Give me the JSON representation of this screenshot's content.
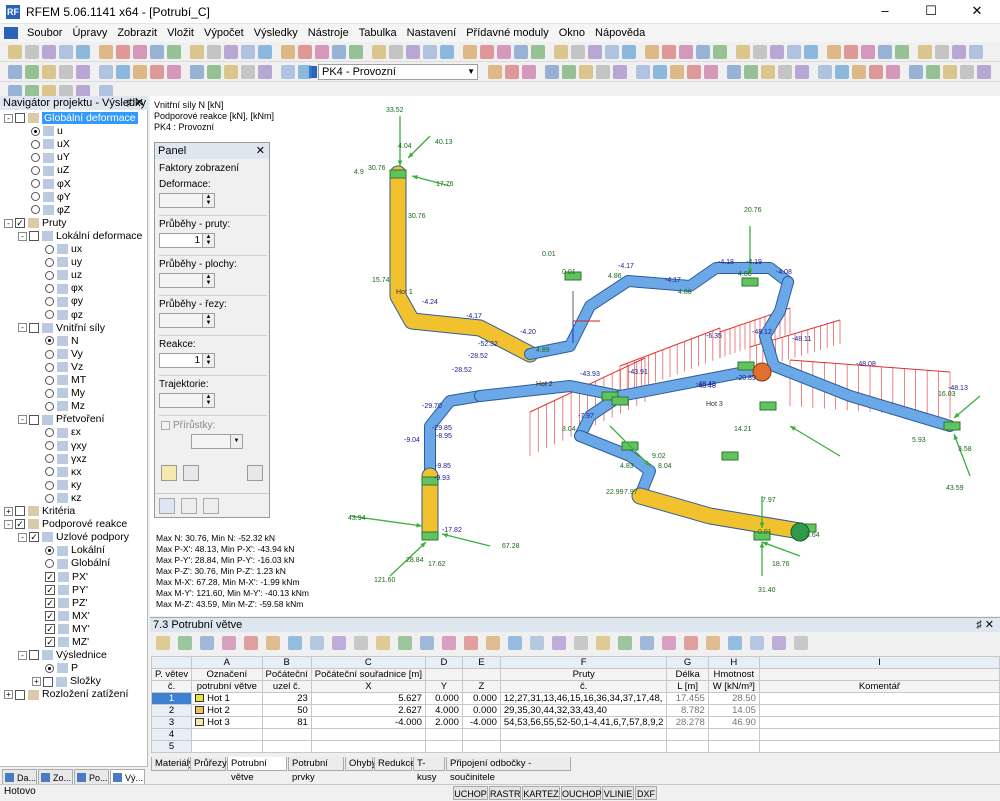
{
  "window": {
    "title": "RFEM 5.06.1141 x64 - [Potrubí_C]",
    "app_icon_text": "RF"
  },
  "menu": [
    "Soubor",
    "Úpravy",
    "Zobrazit",
    "Vložit",
    "Výpočet",
    "Výsledky",
    "Nástroje",
    "Tabulka",
    "Nastavení",
    "Přídavné moduly",
    "Okno",
    "Nápověda"
  ],
  "toolbar": {
    "load_case": "PK4 - Provozní"
  },
  "navigator": {
    "title": "Navigátor projektu - Výsledky",
    "tabs": [
      "Da...",
      "Zo...",
      "Po...",
      "Vý..."
    ],
    "tree": [
      {
        "level": 0,
        "kind": "chk",
        "label": "Globální deformace",
        "selected": true,
        "expander": "-"
      },
      {
        "level": 1,
        "kind": "radio",
        "on": true,
        "label": "u"
      },
      {
        "level": 1,
        "kind": "radio",
        "label": "uX"
      },
      {
        "level": 1,
        "kind": "radio",
        "label": "uY"
      },
      {
        "level": 1,
        "kind": "radio",
        "label": "uZ"
      },
      {
        "level": 1,
        "kind": "radio",
        "label": "φX"
      },
      {
        "level": 1,
        "kind": "radio",
        "label": "φY"
      },
      {
        "level": 1,
        "kind": "radio",
        "label": "φZ"
      },
      {
        "level": 0,
        "kind": "chk",
        "checked": true,
        "label": "Pruty",
        "expander": "-"
      },
      {
        "level": 1,
        "kind": "chk",
        "label": "Lokální deformace",
        "expander": "-"
      },
      {
        "level": 2,
        "kind": "radio",
        "label": "ux"
      },
      {
        "level": 2,
        "kind": "radio",
        "label": "uy"
      },
      {
        "level": 2,
        "kind": "radio",
        "label": "uz"
      },
      {
        "level": 2,
        "kind": "radio",
        "label": "φx"
      },
      {
        "level": 2,
        "kind": "radio",
        "label": "φy"
      },
      {
        "level": 2,
        "kind": "radio",
        "label": "φz"
      },
      {
        "level": 1,
        "kind": "chk",
        "label": "Vnitřní síly",
        "expander": "-"
      },
      {
        "level": 2,
        "kind": "radio",
        "on": true,
        "label": "N"
      },
      {
        "level": 2,
        "kind": "radio",
        "label": "Vy"
      },
      {
        "level": 2,
        "kind": "radio",
        "label": "Vz"
      },
      {
        "level": 2,
        "kind": "radio",
        "label": "MT"
      },
      {
        "level": 2,
        "kind": "radio",
        "label": "My"
      },
      {
        "level": 2,
        "kind": "radio",
        "label": "Mz"
      },
      {
        "level": 1,
        "kind": "chk",
        "label": "Přetvoření",
        "expander": "-"
      },
      {
        "level": 2,
        "kind": "radio",
        "label": "εx"
      },
      {
        "level": 2,
        "kind": "radio",
        "label": "γxy"
      },
      {
        "level": 2,
        "kind": "radio",
        "label": "γxz"
      },
      {
        "level": 2,
        "kind": "radio",
        "label": "κx"
      },
      {
        "level": 2,
        "kind": "radio",
        "label": "κy"
      },
      {
        "level": 2,
        "kind": "radio",
        "label": "κz"
      },
      {
        "level": 0,
        "kind": "chk",
        "label": "Kritéria",
        "expander": "+"
      },
      {
        "level": 0,
        "kind": "chk",
        "checked": true,
        "label": "Podporové reakce",
        "expander": "-"
      },
      {
        "level": 1,
        "kind": "chk",
        "checked": true,
        "label": "Uzlové podpory",
        "expander": "-"
      },
      {
        "level": 2,
        "kind": "radio",
        "on": true,
        "label": "Lokální"
      },
      {
        "level": 2,
        "kind": "radio",
        "label": "Globální"
      },
      {
        "level": 2,
        "kind": "chk",
        "checked": true,
        "label": "PX'"
      },
      {
        "level": 2,
        "kind": "chk",
        "checked": true,
        "label": "PY'"
      },
      {
        "level": 2,
        "kind": "chk",
        "checked": true,
        "label": "PZ'"
      },
      {
        "level": 2,
        "kind": "chk",
        "checked": true,
        "label": "MX'"
      },
      {
        "level": 2,
        "kind": "chk",
        "checked": true,
        "label": "MY'"
      },
      {
        "level": 2,
        "kind": "chk",
        "checked": true,
        "label": "MZ'"
      },
      {
        "level": 1,
        "kind": "chk",
        "label": "Výslednice",
        "expander": "-"
      },
      {
        "level": 2,
        "kind": "radio",
        "on": true,
        "label": "P"
      },
      {
        "level": 2,
        "kind": "chk",
        "label": "Složky",
        "expander": "+"
      },
      {
        "level": 0,
        "kind": "chk",
        "label": "Rozložení zatížení",
        "expander": "+"
      }
    ]
  },
  "viewport": {
    "info": [
      "Vnitřní síly N [kN]",
      "Podporové reakce [kN], [kNm]",
      "PK4 : Provozní"
    ],
    "stats": [
      "Max N: 30.76, Min N: -52.32 kN",
      "Max P-X': 48.13, Min P-X': -43.94 kN",
      "Max P-Y': 28.84, Min P-Y': -16.03 kN",
      "Max P-Z': 30.76, Min P-Z': 1.23 kN",
      "Max M-X': 67.28, Min M-X': -1.99 kNm",
      "Max M-Y': 121.60, Min M-Y': -40.13 kNm",
      "Max M-Z': 43.59, Min M-Z': -59.58 kNm"
    ],
    "labels": [
      "33.52",
      "4.04",
      "40.13",
      "4.9",
      "30.76",
      "17.76",
      "30.76",
      "15.74",
      "Hot 1",
      "-4.24",
      "-4.17",
      "-4.20",
      "4.89",
      "-52.32",
      "0.01",
      "0.01",
      "-4.17",
      "4.86",
      "-4.17",
      "4.86",
      "-4.18",
      "4.86",
      "-4.19",
      "-4.08",
      "20.76",
      "-48.12",
      "-48.11",
      "-6.35",
      "-20.89",
      "-48.08",
      "-48.48",
      "-28.52",
      "-43.93",
      "-48.48",
      "-43.91",
      "-48.13",
      "-28.52",
      "-29.70",
      "-29.85",
      "Hot 2",
      "Hot 3",
      "16.03",
      "-9.04",
      "-8.95",
      "-9.85",
      "-9.93",
      "-17.82",
      "28.84",
      "17.62",
      "67.28",
      "43.94",
      "121.60",
      "8.04",
      "-7.97",
      "4.83",
      "22.99",
      "7.97",
      "9.02",
      "8.04",
      "14.21",
      "5.93",
      "3.58",
      "43.59",
      "0.01",
      "3.64",
      "7.97",
      "18.76",
      "31.40"
    ]
  },
  "panel": {
    "title": "Panel",
    "subtitle": "Faktory zobrazení",
    "groups": [
      {
        "label": "Deformace:",
        "value": "",
        "enabled": false
      },
      {
        "label": "Průběhy - pruty:",
        "value": "1",
        "enabled": true
      },
      {
        "label": "Průběhy - plochy:",
        "value": "",
        "enabled": false
      },
      {
        "label": "Průběhy - řezy:",
        "value": "",
        "enabled": false
      },
      {
        "label": "Reakce:",
        "value": "1",
        "enabled": true
      },
      {
        "label": "Trajektorie:",
        "value": "",
        "enabled": false
      }
    ],
    "increments_label": "Přírůstky:"
  },
  "table": {
    "title": "7.3 Potrubní větve",
    "col_letters": [
      "",
      "A",
      "B",
      "C",
      "D",
      "E",
      "F",
      "G",
      "H",
      "I"
    ],
    "header1": [
      "P. větev",
      "Označení",
      "Počáteční",
      "Počáteční souřadnice [m]",
      "",
      "",
      "Pruty",
      "Délka",
      "Hmotnost",
      ""
    ],
    "header2": [
      "č.",
      "potrubní větve",
      "uzel č.",
      "X",
      "Y",
      "Z",
      "č.",
      "L [m]",
      "W [kN/m³]",
      "Komentář"
    ],
    "rows": [
      {
        "no": "1",
        "name": "Hot 1",
        "color": "#f0e040",
        "node": "23",
        "x": "5.627",
        "y": "0.000",
        "z": "0.000",
        "members": "12,27,31,13,46,15,16,36,34,37,17,48,",
        "length": "17.455",
        "weight": "28.50"
      },
      {
        "no": "2",
        "name": "Hot 2",
        "color": "#f0c060",
        "node": "50",
        "x": "2.627",
        "y": "4.000",
        "z": "0.000",
        "members": "29,35,30,44,32,33,43,40",
        "length": "8.782",
        "weight": "14.05"
      },
      {
        "no": "3",
        "name": "Hot 3",
        "color": "#f4e8b0",
        "node": "81",
        "x": "-4.000",
        "y": "2.000",
        "z": "-4.000",
        "members": "54,53,56,55,52-50,1-4,41,6,7,57,8,9,2",
        "length": "28.278",
        "weight": "46.90"
      },
      {
        "no": "4",
        "name": "",
        "color": "",
        "node": "",
        "x": "",
        "y": "",
        "z": "",
        "members": "",
        "length": "",
        "weight": ""
      },
      {
        "no": "5",
        "name": "",
        "color": "",
        "node": "",
        "x": "",
        "y": "",
        "z": "",
        "members": "",
        "length": "",
        "weight": ""
      }
    ],
    "tabs": [
      "Materiály",
      "Průřezy",
      "Potrubní větve",
      "Potrubní prvky",
      "Ohyby",
      "Redukce",
      "T-kusy",
      "Připojení odbočky - součinitele"
    ],
    "active_tab": "Potrubní větve"
  },
  "status": {
    "ready": "Hotovo",
    "buttons": [
      "UCHOP",
      "RASTR",
      "KARTEZ",
      "OUCHOP",
      "VLINIE",
      "DXF"
    ]
  }
}
